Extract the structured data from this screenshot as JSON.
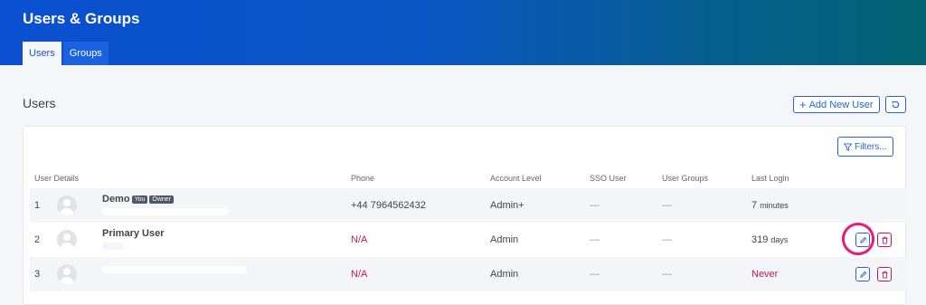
{
  "header": {
    "title": "Users & Groups",
    "tabs": [
      {
        "label": "Users",
        "active": true
      },
      {
        "label": "Groups",
        "active": false
      }
    ]
  },
  "section": {
    "title": "Users",
    "add_button": "Add New User",
    "add_icon": "plus-icon",
    "refresh_icon": "refresh-icon",
    "filters_button": "Filters...",
    "filters_icon": "funnel-icon"
  },
  "table": {
    "headers": {
      "user_details": "User Details",
      "phone": "Phone",
      "account_level": "Account Level",
      "sso_user": "SSO User",
      "user_groups": "User Groups",
      "last_login": "Last Login"
    },
    "rows": [
      {
        "num": "1",
        "name": "Demo",
        "badges": [
          "You",
          "Owner"
        ],
        "phone": "+44 7964562432",
        "level": "Admin+",
        "sso": "—",
        "groups": "—",
        "login_value": "7",
        "login_unit": "minutes"
      },
      {
        "num": "2",
        "name": "Primary User",
        "badges": [],
        "phone": "N/A",
        "level": "Admin",
        "sso": "—",
        "groups": "—",
        "login_value": "319",
        "login_unit": "days"
      },
      {
        "num": "3",
        "name": "",
        "badges": [],
        "phone": "N/A",
        "level": "Admin",
        "sso": "—",
        "groups": "—",
        "login_value": "Never",
        "login_unit": ""
      }
    ]
  },
  "colors": {
    "accent": "#2a62d6",
    "danger": "#c2185b",
    "highlight": "#e8197a"
  }
}
